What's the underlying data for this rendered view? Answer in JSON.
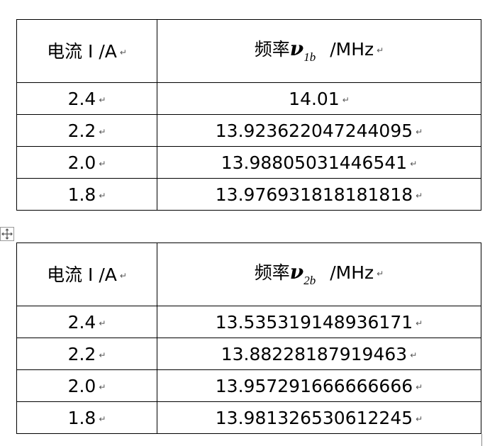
{
  "tables": [
    {
      "header": {
        "col1": "电流 I /A",
        "col2_prefix": "频率",
        "col2_symbol": "ν",
        "col2_subscript": "1b",
        "col2_unit": "/MHz"
      },
      "rows": [
        {
          "current": "2.4",
          "frequency": "14.01"
        },
        {
          "current": "2.2",
          "frequency": "13.923622047244095"
        },
        {
          "current": "2.0",
          "frequency": "13.98805031446541"
        },
        {
          "current": "1.8",
          "frequency": "13.976931818181818"
        }
      ]
    },
    {
      "header": {
        "col1": "电流 I /A",
        "col2_prefix": "频率",
        "col2_symbol": "ν",
        "col2_subscript": "2b",
        "col2_unit": "/MHz"
      },
      "rows": [
        {
          "current": "2.4",
          "frequency": "13.535319148936171"
        },
        {
          "current": "2.2",
          "frequency": "13.88228187919463"
        },
        {
          "current": "2.0",
          "frequency": "13.957291666666666"
        },
        {
          "current": "1.8",
          "frequency": "13.981326530612245"
        }
      ]
    }
  ],
  "paragraph_mark": "↵",
  "icons": {
    "table_move_handle": "move-arrows-icon"
  }
}
